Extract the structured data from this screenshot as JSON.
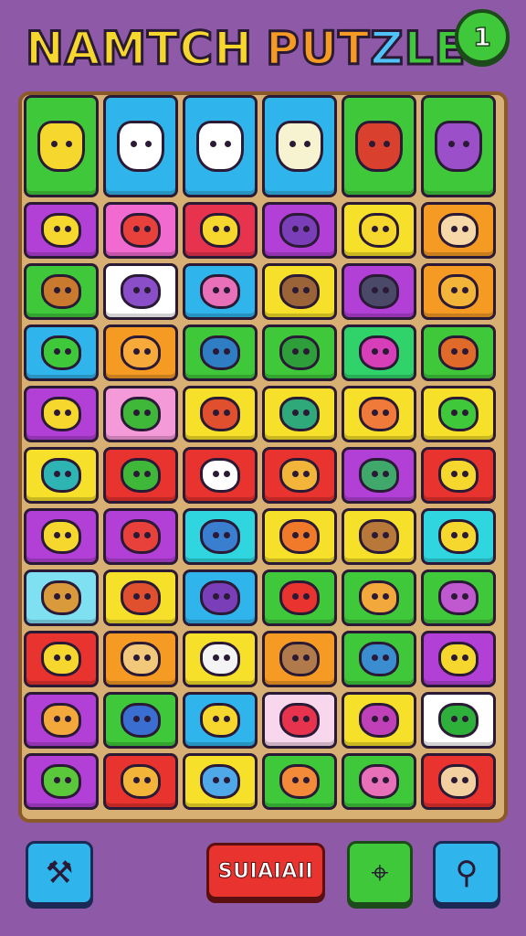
{
  "header": {
    "title_parts": [
      {
        "text": "NAMTCH",
        "color": "#f6d72e"
      },
      {
        "text": " ",
        "color": "#ffffff"
      },
      {
        "text": "PUT",
        "color": "#f59a23"
      },
      {
        "text": "Z",
        "color": "#4fc3f7"
      },
      {
        "text": "LE",
        "color": "#3fc93a"
      }
    ],
    "level": "1"
  },
  "board": {
    "rows": [
      [
        {
          "bg": "#3fc93a",
          "icon": "yellow-winged-creature",
          "fill": "#f6d72e"
        },
        {
          "bg": "#2fb4ec",
          "icon": "white-bear-banner",
          "fill": "#ffffff"
        },
        {
          "bg": "#2fb4ec",
          "icon": "white-winged-cat",
          "fill": "#ffffff"
        },
        {
          "bg": "#2fb4ec",
          "icon": "white-winged-dog",
          "fill": "#f7f2d0"
        },
        {
          "bg": "#3fc93a",
          "icon": "red-winged-beast",
          "fill": "#d9402e"
        },
        {
          "bg": "#3fc93a",
          "icon": "purple-winged-beast",
          "fill": "#9b4fc8"
        }
      ],
      [
        {
          "bg": "#b23fd6",
          "icon": "yellow-monkey",
          "fill": "#f6d72e"
        },
        {
          "bg": "#f06ad0",
          "icon": "red-bell",
          "fill": "#e8403a"
        },
        {
          "bg": "#e8334f",
          "icon": "yellow-bird",
          "fill": "#f6d72e"
        },
        {
          "bg": "#b23fd6",
          "icon": "purple-ring",
          "fill": "#7a3fb8"
        },
        {
          "bg": "#f6e02a",
          "icon": "yellow-cat",
          "fill": "#f6d72e"
        },
        {
          "bg": "#f59a23",
          "icon": "candy-wrapper",
          "fill": "#f7d8a8"
        }
      ],
      [
        {
          "bg": "#3fc93a",
          "icon": "pencil",
          "fill": "#c97a2e"
        },
        {
          "bg": "#ffffff",
          "icon": "purple-stone",
          "fill": "#8a4fc8"
        },
        {
          "bg": "#2fb4ec",
          "icon": "pink-worm",
          "fill": "#e870b8"
        },
        {
          "bg": "#f6e02a",
          "icon": "brown-bear",
          "fill": "#9a6438"
        },
        {
          "bg": "#b23fd6",
          "icon": "toy-car",
          "fill": "#4a4a68"
        },
        {
          "bg": "#f59a23",
          "icon": "spiral-shell",
          "fill": "#f2b53a"
        }
      ],
      [
        {
          "bg": "#2fb4ec",
          "icon": "green-slice",
          "fill": "#3fc93a"
        },
        {
          "bg": "#f59a23",
          "icon": "orange-sausage",
          "fill": "#f7a93a"
        },
        {
          "bg": "#3fc93a",
          "icon": "blue-bird",
          "fill": "#2f7ec4"
        },
        {
          "bg": "#3fc93a",
          "icon": "green-spiral",
          "fill": "#2e9e3a"
        },
        {
          "bg": "#2fd36a",
          "icon": "magenta-boat",
          "fill": "#d63fb8"
        },
        {
          "bg": "#3fc93a",
          "icon": "fox-face",
          "fill": "#e06a2a"
        }
      ],
      [
        {
          "bg": "#b23fd6",
          "icon": "yellow-crayon",
          "fill": "#f6d72e"
        },
        {
          "bg": "#f49ad8",
          "icon": "green-bottle",
          "fill": "#3fb83a"
        },
        {
          "bg": "#f6e02a",
          "icon": "red-cat",
          "fill": "#e0502e"
        },
        {
          "bg": "#f6e02a",
          "icon": "green-book",
          "fill": "#2fa87a"
        },
        {
          "bg": "#f6e02a",
          "icon": "orange-fish",
          "fill": "#f07a3a"
        },
        {
          "bg": "#f6e02a",
          "icon": "green-leaf",
          "fill": "#3fc93a"
        }
      ],
      [
        {
          "bg": "#f6e02a",
          "icon": "teal-fish",
          "fill": "#2fb4b4"
        },
        {
          "bg": "#e8332f",
          "icon": "green-pod",
          "fill": "#3fb83a"
        },
        {
          "bg": "#e8332f",
          "icon": "white-bunny",
          "fill": "#ffffff"
        },
        {
          "bg": "#e8332f",
          "icon": "gold-medal",
          "fill": "#f2b53a"
        },
        {
          "bg": "#b23fd6",
          "icon": "green-sword",
          "fill": "#3fa86a"
        },
        {
          "bg": "#e8332f",
          "icon": "lion-crest",
          "fill": "#f6d72e"
        }
      ],
      [
        {
          "bg": "#b23fd6",
          "icon": "yellow-blob",
          "fill": "#f6d72e"
        },
        {
          "bg": "#b23fd6",
          "icon": "red-marker",
          "fill": "#e8403a"
        },
        {
          "bg": "#2fd6e0",
          "icon": "blue-fish",
          "fill": "#3a7ed0"
        },
        {
          "bg": "#f6e02a",
          "icon": "orange-spiral",
          "fill": "#f07a2a"
        },
        {
          "bg": "#f6e02a",
          "icon": "cookie",
          "fill": "#b8783a"
        },
        {
          "bg": "#2fd6e0",
          "icon": "yellow-fish",
          "fill": "#f6d72e"
        }
      ],
      [
        {
          "bg": "#7fe0f2",
          "icon": "toast-stick",
          "fill": "#d89a3a"
        },
        {
          "bg": "#f6e02a",
          "icon": "battery-robot",
          "fill": "#e0502e"
        },
        {
          "bg": "#2fb4ec",
          "icon": "purple-puzzle",
          "fill": "#7a3fb8"
        },
        {
          "bg": "#3fc93a",
          "icon": "horned-orb",
          "fill": "#e8332f"
        },
        {
          "bg": "#3fc93a",
          "icon": "orange-dots-stick",
          "fill": "#f2a83a"
        },
        {
          "bg": "#3fc93a",
          "icon": "purple-fish",
          "fill": "#c058d0"
        }
      ],
      [
        {
          "bg": "#e8332f",
          "icon": "treasure-map",
          "fill": "#f6d72e"
        },
        {
          "bg": "#f59a23",
          "icon": "wood-crayon",
          "fill": "#f2c87a"
        },
        {
          "bg": "#f6e02a",
          "icon": "white-stone",
          "fill": "#f4f4f4"
        },
        {
          "bg": "#f59a23",
          "icon": "brown-bear-face",
          "fill": "#b07a4a"
        },
        {
          "bg": "#3fc93a",
          "icon": "fish-bowl",
          "fill": "#3a8ed0"
        },
        {
          "bg": "#b23fd6",
          "icon": "gold-fish",
          "fill": "#f6d72e"
        }
      ],
      [
        {
          "bg": "#b23fd6",
          "icon": "crossed-tools",
          "fill": "#f2a83a"
        },
        {
          "bg": "#3fc93a",
          "icon": "blue-log",
          "fill": "#3a6ed0"
        },
        {
          "bg": "#2fb4ec",
          "icon": "yellow-corn",
          "fill": "#f6d72e"
        },
        {
          "bg": "#f8d6ec",
          "icon": "red-jelly",
          "fill": "#e8334f"
        },
        {
          "bg": "#f6e02a",
          "icon": "purple-flower",
          "fill": "#c040b8"
        },
        {
          "bg": "#ffffff",
          "icon": "green-swirl",
          "fill": "#2eb03a"
        }
      ],
      [
        {
          "bg": "#b23fd6",
          "icon": "green-potion",
          "fill": "#5ac83a"
        },
        {
          "bg": "#e8332f",
          "icon": "orange-swirl",
          "fill": "#f2b53a"
        },
        {
          "bg": "#f6e02a",
          "icon": "blue-cloud-face",
          "fill": "#4fa8e8"
        },
        {
          "bg": "#3fc93a",
          "icon": "orange-crayon",
          "fill": "#f28a3a"
        },
        {
          "bg": "#3fc93a",
          "icon": "pink-fish",
          "fill": "#e870b8"
        },
        {
          "bg": "#e8332f",
          "icon": "tan-cat",
          "fill": "#f2d0a0"
        }
      ]
    ]
  },
  "footer": {
    "hammer_button": {
      "icon": "hammer-icon",
      "color": "#2fb4ec",
      "glyph": "⚒"
    },
    "action_button": {
      "label": "SUIAIAII",
      "color": "#e8332f"
    },
    "hint_button": {
      "icon": "map-pin-icon",
      "color": "#3fc93a",
      "glyph": "⌖"
    },
    "magnify_button": {
      "icon": "magnify-icon",
      "color": "#2fb4ec",
      "glyph": "⚲"
    }
  }
}
